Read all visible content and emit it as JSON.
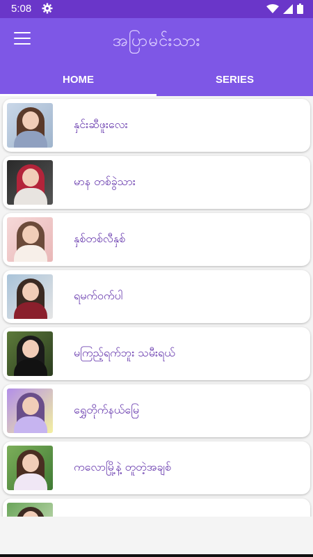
{
  "status_bar": {
    "time": "5:08",
    "icons": [
      "settings-gear-icon",
      "wifi-icon",
      "signal-icon",
      "battery-icon"
    ]
  },
  "app_bar": {
    "title": "အပြာမင်းသား",
    "menu_icon": "hamburger-menu-icon"
  },
  "tabs": [
    {
      "label": "HOME",
      "active": true
    },
    {
      "label": "SERIES",
      "active": false
    }
  ],
  "colors": {
    "primary": "#7e57e6",
    "status_bar": "#6a36c9",
    "title_text": "#5d2ca8",
    "background": "#f4f4f4"
  },
  "items": [
    {
      "title": "နှင်းဆီဖူးလေး",
      "thumb": "photo-thumbnail"
    },
    {
      "title": "မာန တစ်ခွဲသား",
      "thumb": "photo-thumbnail"
    },
    {
      "title": "နှစ်တစ်လီနှစ်",
      "thumb": "photo-thumbnail"
    },
    {
      "title": "ရမက်ဝက်ပါ",
      "thumb": "photo-thumbnail"
    },
    {
      "title": "မကြည့်ရက်ဘူး သမီးရယ်",
      "thumb": "photo-thumbnail"
    },
    {
      "title": "ရွှေတိုက်နယ်မြေ",
      "thumb": "photo-thumbnail"
    },
    {
      "title": "ကလောမြို့နဲ့ တူတဲ့အချစ်",
      "thumb": "photo-thumbnail"
    },
    {
      "title": "",
      "thumb": "photo-thumbnail"
    }
  ]
}
